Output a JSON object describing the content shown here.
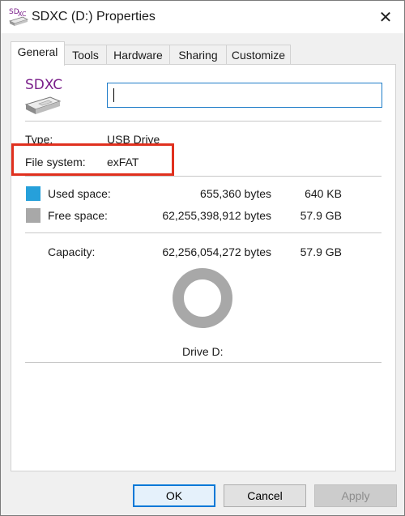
{
  "window": {
    "title": "SDXC (D:) Properties"
  },
  "tabs": [
    {
      "label": "General",
      "active": true
    },
    {
      "label": "Tools"
    },
    {
      "label": "Hardware"
    },
    {
      "label": "Sharing"
    },
    {
      "label": "Customize"
    }
  ],
  "general": {
    "drive_label": "SDXC",
    "name_value": "",
    "type_label": "Type:",
    "type_value": "USB Drive",
    "fs_label": "File system:",
    "fs_value": "exFAT",
    "used": {
      "label": "Used space:",
      "bytes": "655,360 bytes",
      "size": "640 KB",
      "color": "#26a0da"
    },
    "free": {
      "label": "Free space:",
      "bytes": "62,255,398,912 bytes",
      "size": "57.9 GB",
      "color": "#a8a8a8"
    },
    "capacity": {
      "label": "Capacity:",
      "bytes": "62,256,054,272 bytes",
      "size": "57.9 GB"
    },
    "drive_caption": "Drive D:",
    "used_fraction": 1.05e-05
  },
  "buttons": {
    "ok": "OK",
    "cancel": "Cancel",
    "apply": "Apply"
  },
  "colors": {
    "highlight": "#e0301e",
    "focus_border": "#1e7cc8"
  }
}
